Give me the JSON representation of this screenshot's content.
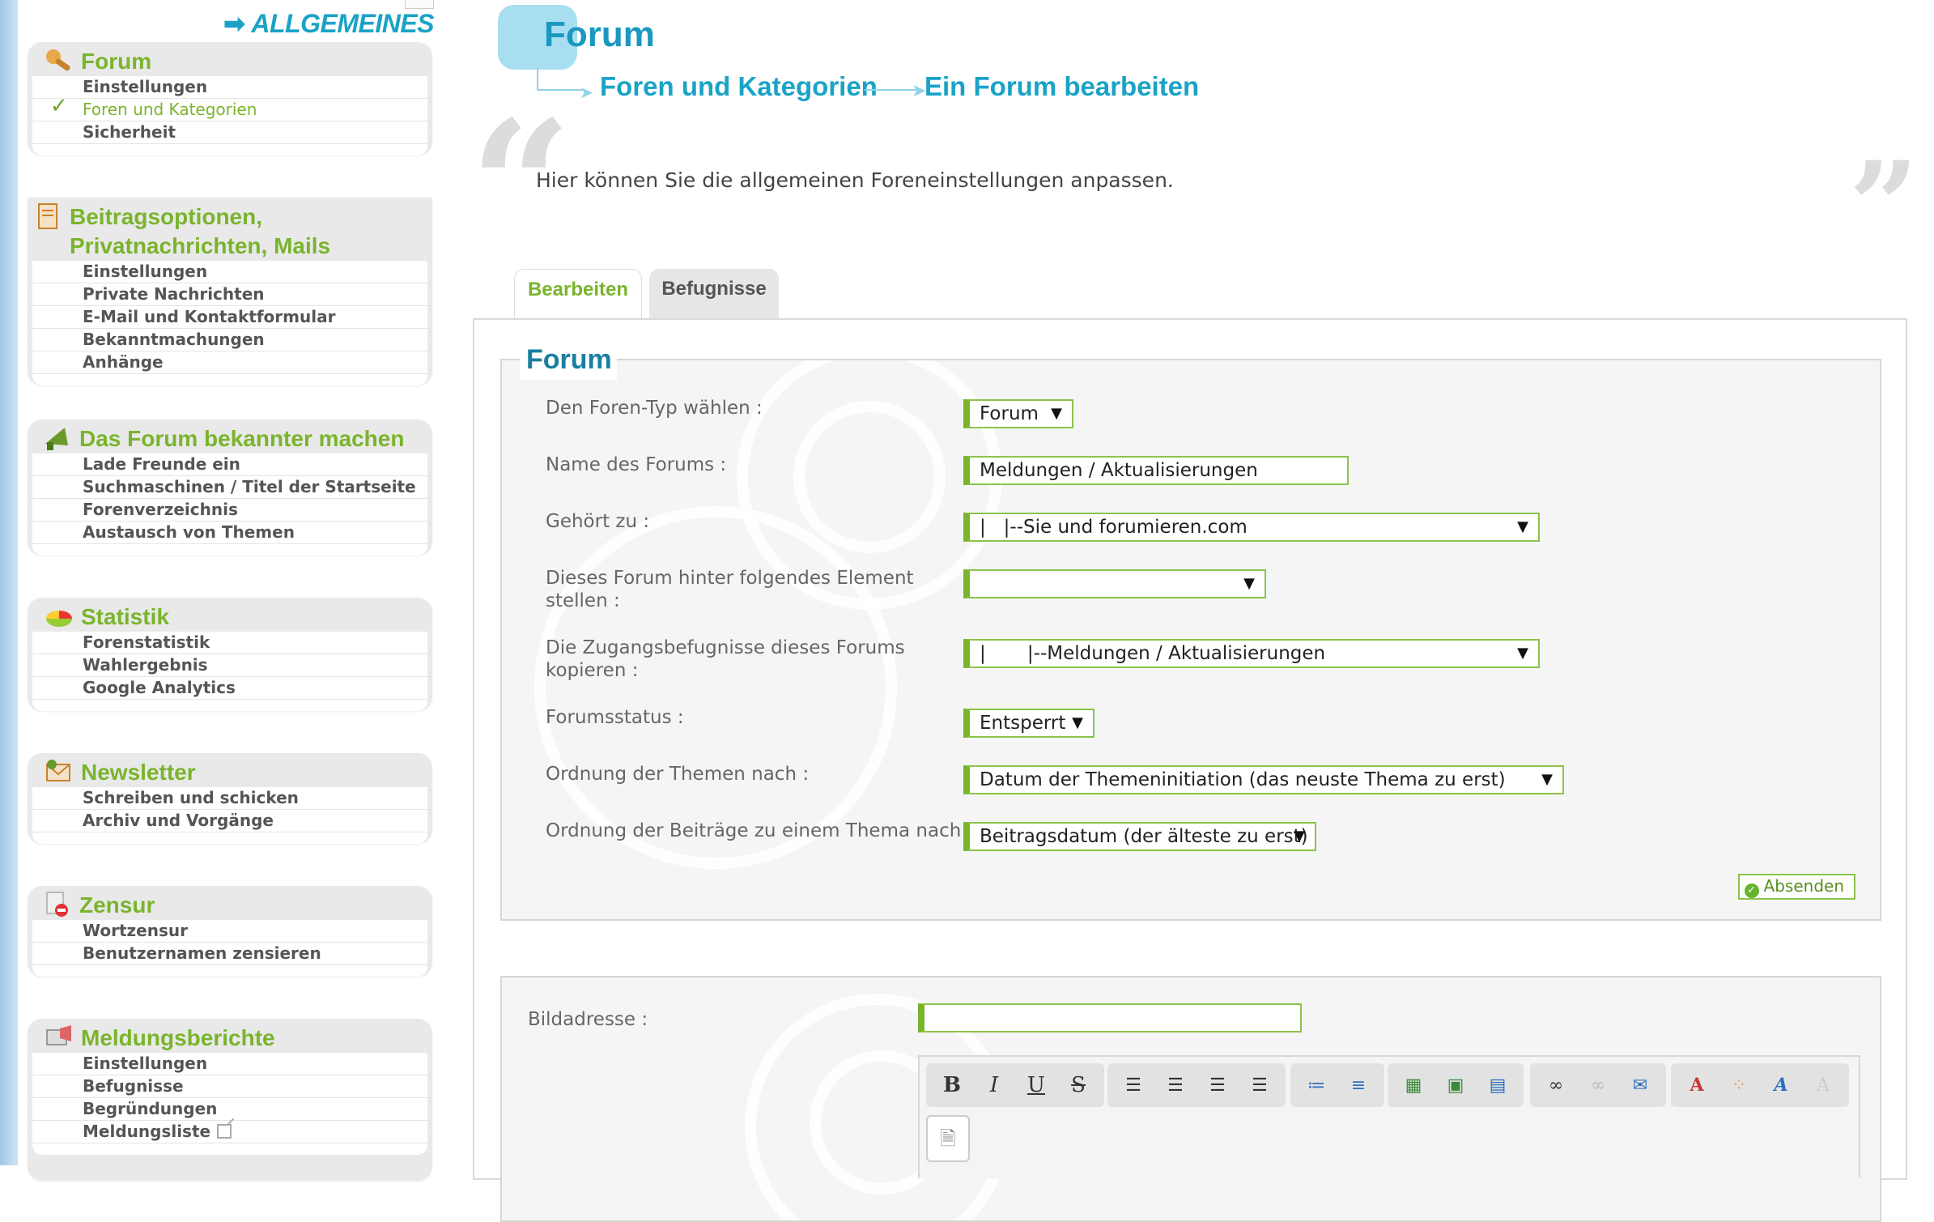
{
  "sidebar": {
    "section_title": "ALLGEMEINES",
    "boxes": [
      {
        "title": "Forum",
        "icon": "tools-icon",
        "items": [
          "Einstellungen",
          "Foren und Kategorien",
          "Sicherheit"
        ],
        "active": 1
      },
      {
        "title": "Beitragsoptionen, Privatnachrichten, Mails",
        "icon": "document-icon",
        "items": [
          "Einstellungen",
          "Private Nachrichten",
          "E-Mail und Kontaktformular",
          "Bekanntmachungen",
          "Anhänge"
        ]
      },
      {
        "title": "Das Forum bekannter machen",
        "icon": "megaphone-icon",
        "items": [
          "Lade Freunde ein",
          "Suchmaschinen / Titel der Startseite",
          "Forenverzeichnis",
          "Austausch von Themen"
        ]
      },
      {
        "title": "Statistik",
        "icon": "pie-chart-icon",
        "items": [
          "Forenstatistik",
          "Wahlergebnis",
          "Google Analytics"
        ]
      },
      {
        "title": "Newsletter",
        "icon": "newsletter-icon",
        "items": [
          "Schreiben und schicken",
          "Archiv und Vorgänge"
        ]
      },
      {
        "title": "Zensur",
        "icon": "censor-icon",
        "items": [
          "Wortzensur",
          "Benutzernamen zensieren"
        ]
      },
      {
        "title": "Meldungsberichte",
        "icon": "report-icon",
        "items": [
          "Einstellungen",
          "Befugnisse",
          "Begründungen",
          "Meldungsliste"
        ]
      }
    ]
  },
  "main": {
    "title": "Forum",
    "breadcrumb": [
      "Foren und Kategorien",
      "Ein Forum bearbeiten"
    ],
    "description": "Hier können Sie die allgemeinen Foreneinstellungen anpassen.",
    "tabs": [
      "Bearbeiten",
      "Befugnisse"
    ],
    "legend": "Forum",
    "fields": [
      {
        "label": "Den Foren-Typ wählen :",
        "value": "Forum"
      },
      {
        "label": "Name des Forums :",
        "value": "Meldungen / Aktualisierungen"
      },
      {
        "label": "Gehört zu :",
        "value": "|   |--Sie und forumieren.com"
      },
      {
        "label": "Dieses Forum hinter folgendes Element stellen :",
        "value": ""
      },
      {
        "label": "Die Zugangsbefugnisse dieses Forums kopieren :",
        "value": "|       |--Meldungen / Aktualisierungen"
      },
      {
        "label": "Forumsstatus :",
        "value": "Entsperrt"
      },
      {
        "label": "Ordnung der Themen nach :",
        "value": "Datum der Themeninitiation (das neuste Thema zu erst)"
      },
      {
        "label": "Ordnung der Beiträge zu einem Thema nach :",
        "value": "Beitragsdatum (der älteste zu erst)"
      }
    ],
    "submit_label": "Absenden",
    "image_label": "Bildadresse :",
    "image_value": ""
  },
  "colors": {
    "accent_green": "#7ab42c",
    "accent_blue": "#1aa3c6"
  }
}
